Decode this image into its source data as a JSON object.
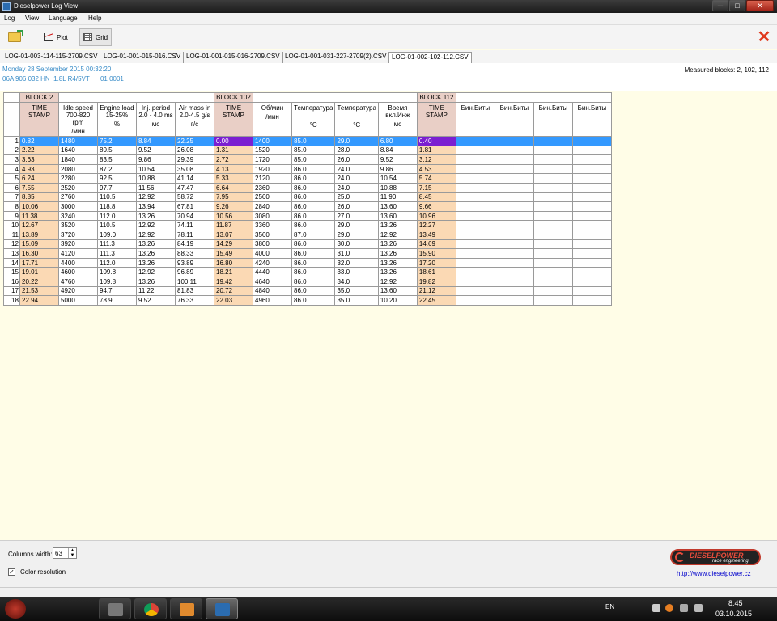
{
  "window": {
    "title": "Dieselpower Log View",
    "min_label": "─",
    "max_label": "□",
    "close_label": "✕"
  },
  "menu": [
    "Log",
    "View",
    "Language",
    "Help"
  ],
  "toolbar": {
    "plot_label": "Plot",
    "grid_label": "Grid",
    "close_symbol": "✕"
  },
  "tabs": [
    "LOG-01-003-114-115-2709.CSV",
    "LOG-01-001-015-016.CSV",
    "LOG-01-001-015-016-2709.CSV",
    "LOG-01-001-031-227-2709(2).CSV",
    "LOG-01-002-102-112.CSV"
  ],
  "active_tab": 4,
  "info": {
    "date": "Monday 28 September 2015 00:32:20",
    "vehicle": "06A 906 032 HN  1.8L R4/5VT      01 0001",
    "measured": "Measured blocks: 2, 102, 112"
  },
  "grid": {
    "blocks": [
      {
        "label": "",
        "span": 1
      },
      {
        "label": "BLOCK 2",
        "span": 1
      },
      {
        "label": "",
        "span": 4
      },
      {
        "label": "BLOCK 102",
        "span": 1
      },
      {
        "label": "",
        "span": 4
      },
      {
        "label": "BLOCK 112",
        "span": 1
      },
      {
        "label": "",
        "span": 4
      }
    ],
    "headers": [
      {
        "name": "",
        "unit": ""
      },
      {
        "name": "TIME STAMP",
        "unit": "",
        "ts": true
      },
      {
        "name": "Idle speed 700-820 rpm",
        "unit": "/мин"
      },
      {
        "name": "Engine load 15-25%",
        "unit": "%"
      },
      {
        "name": "Inj. period 2.0 - 4.0 ms",
        "unit": "мс"
      },
      {
        "name": "Air mass in 2.0-4.5 g/s",
        "unit": "г/с"
      },
      {
        "name": "TIME STAMP",
        "unit": "",
        "ts": true
      },
      {
        "name": "Об/мин",
        "unit": "/мин"
      },
      {
        "name": "Температура",
        "unit": "°C"
      },
      {
        "name": "Температура",
        "unit": "°C"
      },
      {
        "name": "Время вкл.Инж",
        "unit": "мс"
      },
      {
        "name": "TIME STAMP",
        "unit": "",
        "ts": true
      },
      {
        "name": "Бин.Биты",
        "unit": ""
      },
      {
        "name": "Бин.Биты",
        "unit": ""
      },
      {
        "name": "Бин.Биты",
        "unit": ""
      },
      {
        "name": "Бин.Биты",
        "unit": ""
      }
    ],
    "rows": [
      [
        "1",
        "0.82",
        "1480",
        "75.2",
        "8.84",
        "22.25",
        "0.00",
        "1400",
        "85.0",
        "29.0",
        "6.80",
        "0.40",
        "",
        "",
        "",
        ""
      ],
      [
        "2",
        "2.22",
        "1640",
        "80.5",
        "9.52",
        "26.08",
        "1.31",
        "1520",
        "85.0",
        "28.0",
        "8.84",
        "1.81",
        "",
        "",
        "",
        ""
      ],
      [
        "3",
        "3.63",
        "1840",
        "83.5",
        "9.86",
        "29.39",
        "2.72",
        "1720",
        "85.0",
        "26.0",
        "9.52",
        "3.12",
        "",
        "",
        "",
        ""
      ],
      [
        "4",
        "4.93",
        "2080",
        "87.2",
        "10.54",
        "35.08",
        "4.13",
        "1920",
        "86.0",
        "24.0",
        "9.86",
        "4.53",
        "",
        "",
        "",
        ""
      ],
      [
        "5",
        "6.24",
        "2280",
        "92.5",
        "10.88",
        "41.14",
        "5.33",
        "2120",
        "86.0",
        "24.0",
        "10.54",
        "5.74",
        "",
        "",
        "",
        ""
      ],
      [
        "6",
        "7.55",
        "2520",
        "97.7",
        "11.56",
        "47.47",
        "6.64",
        "2360",
        "86.0",
        "24.0",
        "10.88",
        "7.15",
        "",
        "",
        "",
        ""
      ],
      [
        "7",
        "8.85",
        "2760",
        "110.5",
        "12.92",
        "58.72",
        "7.95",
        "2560",
        "86.0",
        "25.0",
        "11.90",
        "8.45",
        "",
        "",
        "",
        ""
      ],
      [
        "8",
        "10.06",
        "3000",
        "118.8",
        "13.94",
        "67.81",
        "9.26",
        "2840",
        "86.0",
        "26.0",
        "13.60",
        "9.66",
        "",
        "",
        "",
        ""
      ],
      [
        "9",
        "11.38",
        "3240",
        "112.0",
        "13.26",
        "70.94",
        "10.56",
        "3080",
        "86.0",
        "27.0",
        "13.60",
        "10.96",
        "",
        "",
        "",
        ""
      ],
      [
        "10",
        "12.67",
        "3520",
        "110.5",
        "12.92",
        "74.11",
        "11.87",
        "3360",
        "86.0",
        "29.0",
        "13.26",
        "12.27",
        "",
        "",
        "",
        ""
      ],
      [
        "11",
        "13.89",
        "3720",
        "109.0",
        "12.92",
        "78.11",
        "13.07",
        "3560",
        "87.0",
        "29.0",
        "12.92",
        "13.49",
        "",
        "",
        "",
        ""
      ],
      [
        "12",
        "15.09",
        "3920",
        "111.3",
        "13.26",
        "84.19",
        "14.29",
        "3800",
        "86.0",
        "30.0",
        "13.26",
        "14.69",
        "",
        "",
        "",
        ""
      ],
      [
        "13",
        "16.30",
        "4120",
        "111.3",
        "13.26",
        "88.33",
        "15.49",
        "4000",
        "86.0",
        "31.0",
        "13.26",
        "15.90",
        "",
        "",
        "",
        ""
      ],
      [
        "14",
        "17.71",
        "4400",
        "112.0",
        "13.26",
        "93.89",
        "16.80",
        "4240",
        "86.0",
        "32.0",
        "13.26",
        "17.20",
        "",
        "",
        "",
        ""
      ],
      [
        "15",
        "19.01",
        "4600",
        "109.8",
        "12.92",
        "96.89",
        "18.21",
        "4440",
        "86.0",
        "33.0",
        "13.26",
        "18.61",
        "",
        "",
        "",
        ""
      ],
      [
        "16",
        "20.22",
        "4760",
        "109.8",
        "13.26",
        "100.11",
        "19.42",
        "4640",
        "86.0",
        "34.0",
        "12.92",
        "19.82",
        "",
        "",
        "",
        ""
      ],
      [
        "17",
        "21.53",
        "4920",
        "94.7",
        "11.22",
        "81.83",
        "20.72",
        "4840",
        "86.0",
        "35.0",
        "13.60",
        "21.12",
        "",
        "",
        "",
        ""
      ],
      [
        "18",
        "22.94",
        "5000",
        "78.9",
        "9.52",
        "76.33",
        "22.03",
        "4960",
        "86.0",
        "35.0",
        "10.20",
        "22.45",
        "",
        "",
        "",
        ""
      ]
    ],
    "selected_row": 0
  },
  "bottom": {
    "columns_width_label": "Columns width:",
    "columns_width_value": "63",
    "color_resolution_label": "Color resolution",
    "color_resolution_checked": true,
    "logo_name": "DIESELPOWER",
    "logo_tagline": "race engineering",
    "link": "http://www.dieselpower.cz"
  },
  "taskbar": {
    "language": "EN",
    "time": "8:45",
    "date": "03.10.2015"
  },
  "colors": {
    "accent_blue": "#3399ff",
    "selected_ts": "#7b1fd1",
    "ts_cell": "#fbd9b4",
    "block_header": "#e9cfc6",
    "info_text": "#3a8dc8",
    "background": "#fffde7"
  }
}
